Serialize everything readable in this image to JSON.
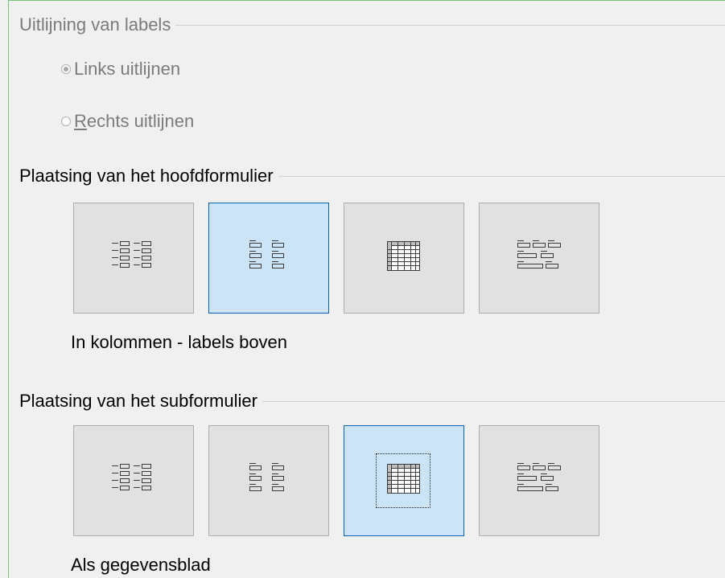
{
  "label_alignment": {
    "title": "Uitlijning van labels",
    "options": [
      {
        "label_pre": "",
        "accel": "",
        "label_post": "Links uitlijnen",
        "checked": true
      },
      {
        "label_pre": "",
        "accel": "R",
        "label_post": "echts uitlijnen",
        "checked": false
      }
    ]
  },
  "main_form": {
    "title": "Plaatsing van het hoofdformulier",
    "selected_index": 1,
    "layouts": [
      {
        "icon": "columnar-labels-left-icon"
      },
      {
        "icon": "columnar-labels-top-icon"
      },
      {
        "icon": "datasheet-icon"
      },
      {
        "icon": "in-blocks-labels-top-icon"
      }
    ],
    "caption": "In kolommen - labels boven"
  },
  "sub_form": {
    "title": "Plaatsing van het subformulier",
    "selected_index": 2,
    "layouts": [
      {
        "icon": "columnar-labels-left-icon"
      },
      {
        "icon": "columnar-labels-top-icon"
      },
      {
        "icon": "datasheet-icon"
      },
      {
        "icon": "in-blocks-labels-top-icon"
      }
    ],
    "caption": "Als gegevensblad"
  },
  "colors": {
    "background": "#f0f0f0",
    "tile": "#e1e1e1",
    "tile_selected": "#cce4f7",
    "selected_border": "#0a5fb0",
    "frame_border": "#7ac27a"
  }
}
